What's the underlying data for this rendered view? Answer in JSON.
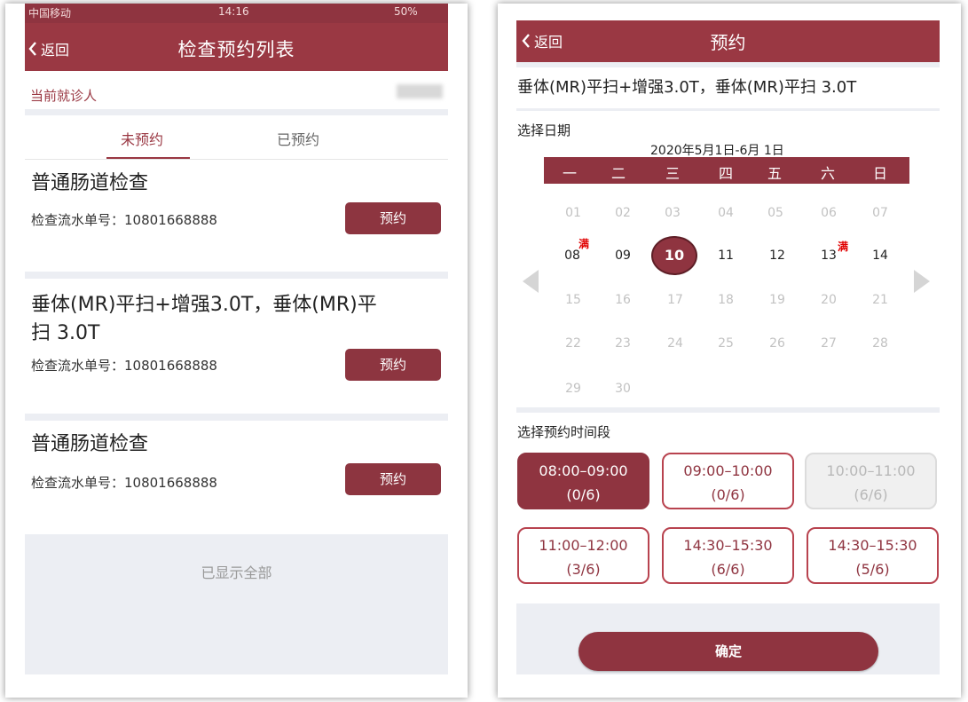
{
  "left": {
    "status_bar": {
      "carrier": "中国移动",
      "time": "14:16",
      "battery": "50%"
    },
    "nav": {
      "back_label": "返回",
      "title": "检查预约列表"
    },
    "patient": {
      "label": "当前就诊人"
    },
    "tabs": [
      {
        "label": "未预约"
      },
      {
        "label": "已预约"
      }
    ],
    "items": [
      {
        "title": "普通肠道检查",
        "serial": "检查流水单号：10801668888",
        "button": "预约"
      },
      {
        "title_line1": "垂体(MR)平扫+增强3.0T，垂体(MR)平",
        "title_line2": "扫 3.0T",
        "serial": "检查流水单号：10801668888",
        "button": "预约"
      },
      {
        "title": "普通肠道检查",
        "serial": "检查流水单号：10801668888",
        "button": "预约"
      }
    ],
    "footer": "已显示全部"
  },
  "right": {
    "nav": {
      "back_label": "返回",
      "title": "预约"
    },
    "exam_name": "垂体(MR)平扫+增强3.0T，垂体(MR)平扫 3.0T",
    "select_date_label": "选择日期",
    "date_range": "2020年5月1日-6月 1日",
    "weekdays": [
      "一",
      "二",
      "三",
      "四",
      "五",
      "六",
      "日"
    ],
    "weeks": [
      [
        "01",
        "02",
        "03",
        "04",
        "05",
        "06",
        "07"
      ],
      [
        "08",
        "09",
        "10",
        "11",
        "12",
        "13",
        "14"
      ],
      [
        "15",
        "16",
        "17",
        "18",
        "19",
        "20",
        "21"
      ],
      [
        "22",
        "23",
        "24",
        "25",
        "26",
        "27",
        "28"
      ],
      [
        "29",
        "30"
      ]
    ],
    "full_label": "满",
    "select_slot_label": "选择预约时间段",
    "slots": [
      {
        "time": "08:00–09:00",
        "count": "(0/6)"
      },
      {
        "time": "09:00–10:00",
        "count": "(0/6)"
      },
      {
        "time": "10:00–11:00",
        "count": "(6/6)"
      },
      {
        "time": "11:00–12:00",
        "count": "(3/6)"
      },
      {
        "time": "14:30–15:30",
        "count": "(6/6)"
      },
      {
        "time": "14:30–15:30",
        "count": "(5/6)"
      }
    ],
    "confirm_label": "确定",
    "colors": {
      "brand": "#8f3440",
      "full_badge": "#e00000",
      "disabled": "#b8b8b8"
    }
  }
}
